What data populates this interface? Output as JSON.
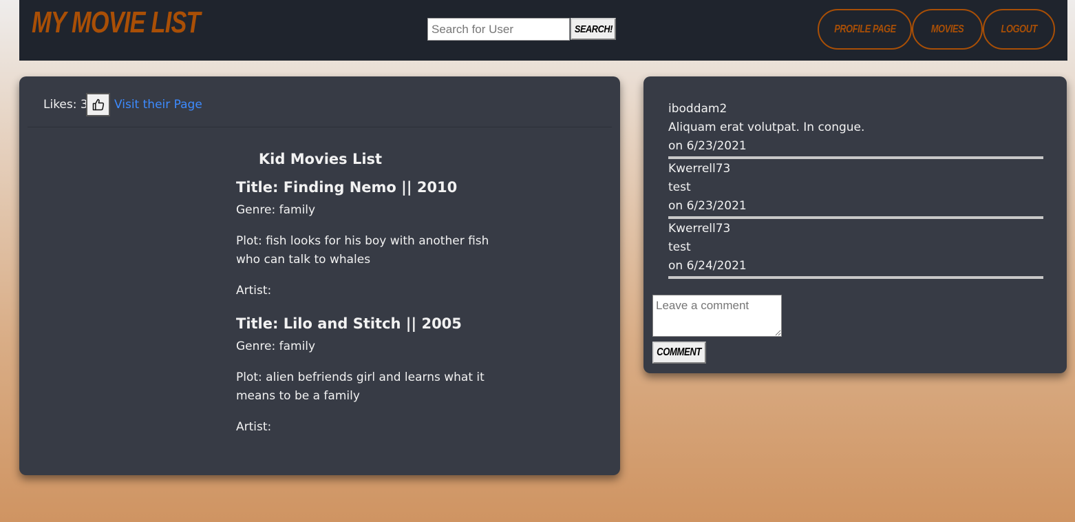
{
  "navbar": {
    "brand": "My Movie List",
    "search_placeholder": "Search for User",
    "search_value": "",
    "search_button": "Search!",
    "profile_button": "Profile Page",
    "movies_button": "Movies",
    "logout_button": "Logout",
    "accent_color": "#a94f06"
  },
  "list_card": {
    "likes_label": "Likes: 3",
    "like_icon": "thumbs-up-icon",
    "visit_link": "Visit their Page",
    "list_title": "Kid Movies List",
    "movies": [
      {
        "title": "Title: Finding Nemo || 2010",
        "genre": "Genre: family",
        "plot": "Plot: fish looks for his boy with another fish who can talk to whales",
        "artist": "Artist:"
      },
      {
        "title": "Title: Lilo and Stitch || 2005",
        "genre": "Genre: family",
        "plot": "Plot: alien befriends girl and learns what it means to be a family",
        "artist": "Artist:"
      }
    ]
  },
  "comments_card": {
    "comments": [
      {
        "user": "iboddam2",
        "text": "Aliquam erat volutpat. In congue.",
        "date": "on 6/23/2021"
      },
      {
        "user": "Kwerrell73",
        "text": "test",
        "date": "on 6/23/2021"
      },
      {
        "user": "Kwerrell73",
        "text": "test",
        "date": "on 6/24/2021"
      }
    ],
    "comment_placeholder": "Leave a comment",
    "comment_value": "",
    "comment_button": "Comment"
  }
}
